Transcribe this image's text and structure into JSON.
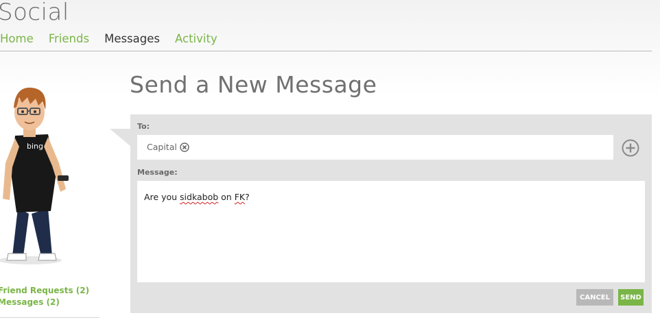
{
  "app": {
    "title": "Social"
  },
  "nav": [
    {
      "label": "Home",
      "active": false
    },
    {
      "label": "Friends",
      "active": false
    },
    {
      "label": "Messages",
      "active": true
    },
    {
      "label": "Activity",
      "active": false
    }
  ],
  "sidebar": {
    "avatar_shirt_text": "bing",
    "links": [
      {
        "label": "Friend Requests (2)"
      },
      {
        "label": "Messages (2)"
      }
    ]
  },
  "compose": {
    "title": "Send a New Message",
    "to_label": "To:",
    "recipients": [
      {
        "name": "Capital"
      }
    ],
    "message_label": "Message:",
    "message_parts": [
      {
        "text": "Are you ",
        "misspelled": false
      },
      {
        "text": "sidkabob",
        "misspelled": true
      },
      {
        "text": " on ",
        "misspelled": false
      },
      {
        "text": "FK",
        "misspelled": true
      },
      {
        "text": "?",
        "misspelled": false
      }
    ],
    "cancel_label": "CANCEL",
    "send_label": "SEND"
  },
  "colors": {
    "accent": "#7ab547",
    "panel": "#e2e2e2",
    "title_text": "#707070",
    "cancel_button": "#b8b8b8"
  },
  "icons": {
    "remove_recipient": "circle-x-icon",
    "add_recipient": "circle-plus-icon"
  }
}
